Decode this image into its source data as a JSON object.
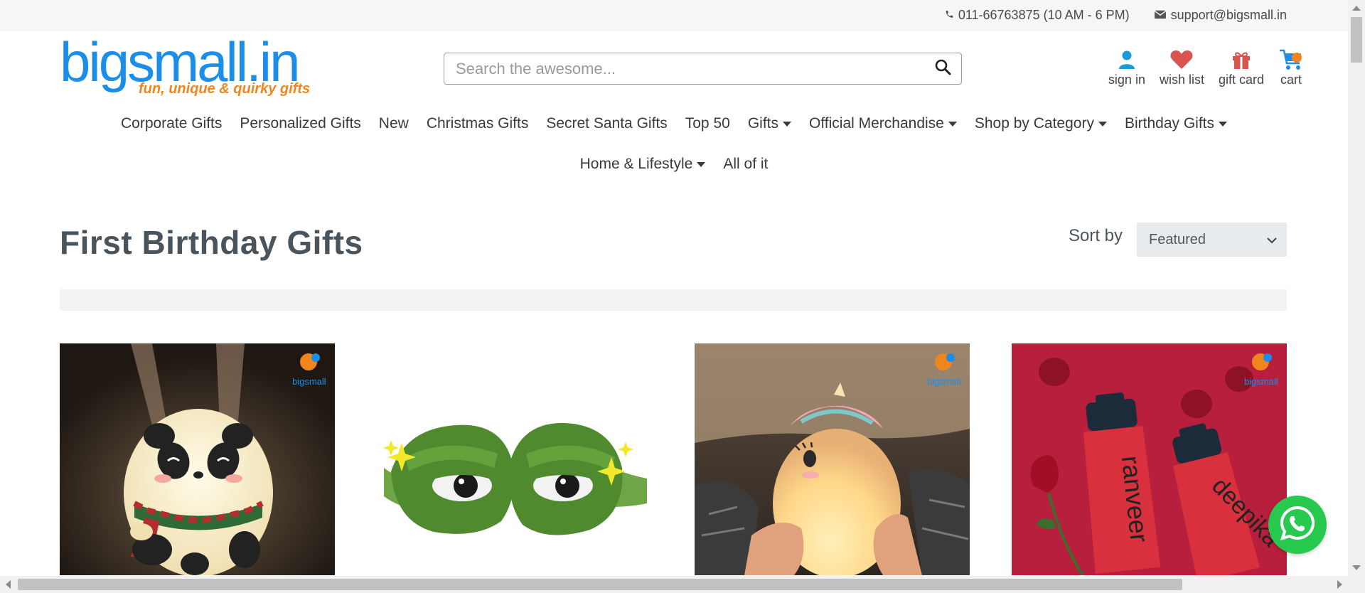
{
  "topbar": {
    "phone": "011-66763875 (10 AM - 6 PM)",
    "email": "support@bigsmall.in"
  },
  "logo": {
    "brand": "bigsmall.in",
    "tagline": "fun, unique & quirky gifts"
  },
  "search": {
    "placeholder": "Search the awesome..."
  },
  "header_icons": [
    {
      "label": "sign in",
      "icon": "user-icon",
      "color": "#1a9bd7"
    },
    {
      "label": "wish list",
      "icon": "heart-icon",
      "color": "#d9534f"
    },
    {
      "label": "gift card",
      "icon": "gift-icon",
      "color": "#d9534f"
    },
    {
      "label": "cart",
      "icon": "cart-icon",
      "color": "#1a8ee8"
    }
  ],
  "nav": {
    "row1": [
      {
        "label": "Corporate Gifts",
        "dropdown": false
      },
      {
        "label": "Personalized Gifts",
        "dropdown": false
      },
      {
        "label": "New",
        "dropdown": false
      },
      {
        "label": "Christmas Gifts",
        "dropdown": false
      },
      {
        "label": "Secret Santa Gifts",
        "dropdown": false
      },
      {
        "label": "Top 50",
        "dropdown": false
      },
      {
        "label": "Gifts",
        "dropdown": true
      },
      {
        "label": "Official Merchandise",
        "dropdown": true
      },
      {
        "label": "Shop by Category",
        "dropdown": true
      },
      {
        "label": "Birthday Gifts",
        "dropdown": true
      }
    ],
    "row2": [
      {
        "label": "Home & Lifestyle",
        "dropdown": true
      },
      {
        "label": "All of it",
        "dropdown": false
      }
    ]
  },
  "page": {
    "title": "First Birthday Gifts",
    "sort_label": "Sort by",
    "sort_value": "Featured"
  },
  "products": [
    {
      "name": "panda-lamp",
      "watermark": "bigsmall.in"
    },
    {
      "name": "frog-eye-mask",
      "watermark": ""
    },
    {
      "name": "unicorn-lamp",
      "watermark": "bigsmall.in"
    },
    {
      "name": "personalized-bottles",
      "watermark": "bigsmall.in",
      "bottle_texts": [
        "ranveer",
        "deepika"
      ]
    }
  ],
  "colors": {
    "brand_blue": "#1a8ee8",
    "brand_orange": "#f0851d",
    "title_gray": "#4a545c",
    "whatsapp_green": "#27c94f"
  }
}
